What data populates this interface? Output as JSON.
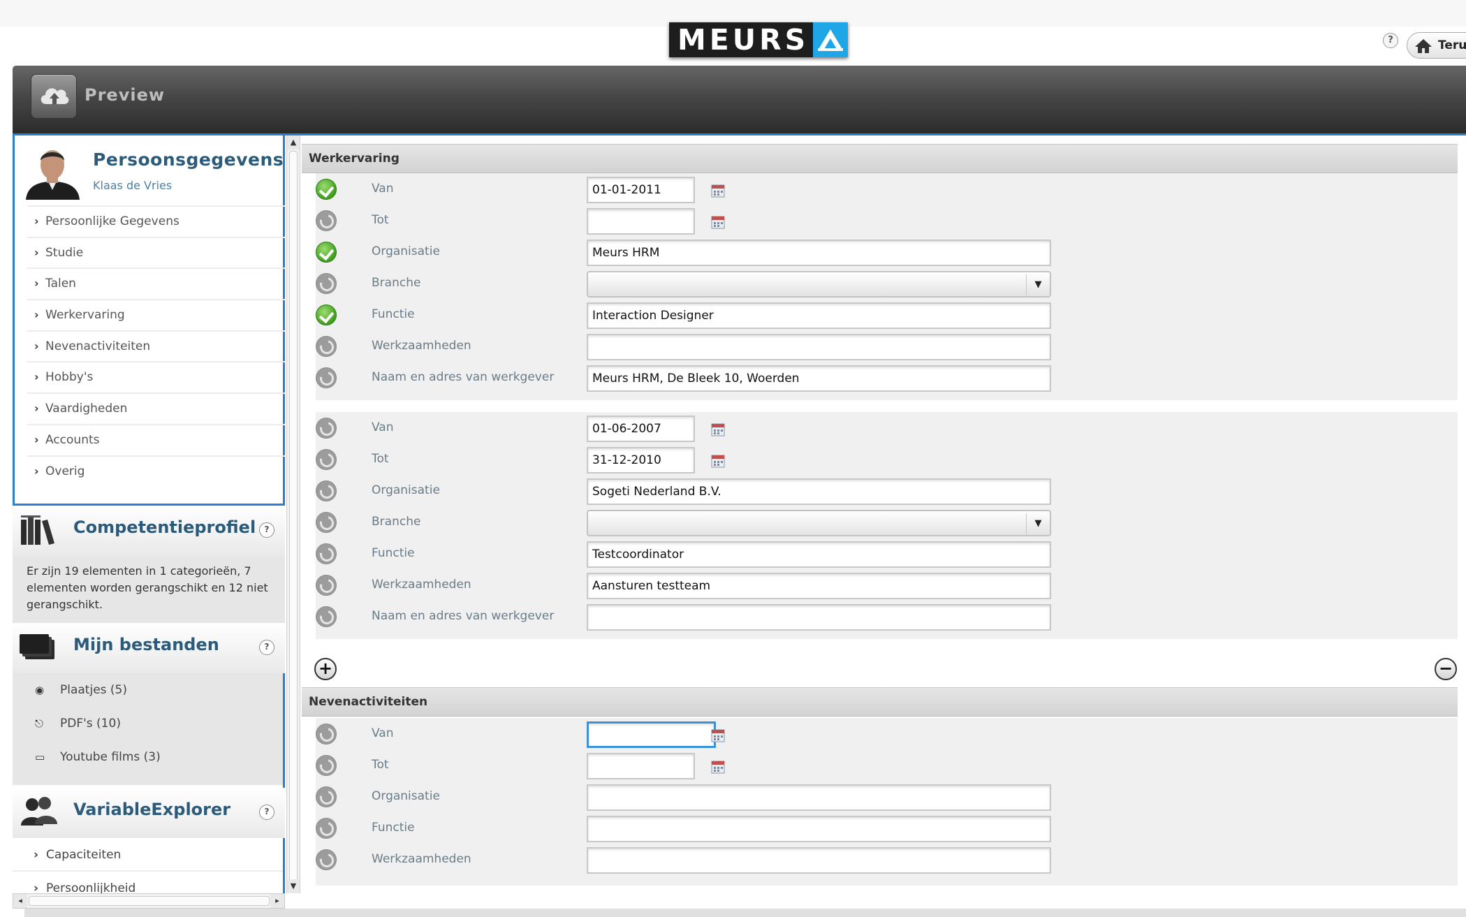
{
  "header": {
    "logo_text": "MEURS",
    "help_label": "?",
    "back_button": "Teru",
    "app_title": "Preview",
    "accent_color": "#2b7fcf",
    "logo_accent_color": "#1ea6e6"
  },
  "sidebar": {
    "profile": {
      "title": "Persoonsgegevens",
      "name": "Klaas de  Vries",
      "items": [
        {
          "label": "Persoonlijke Gegevens"
        },
        {
          "label": "Studie"
        },
        {
          "label": "Talen"
        },
        {
          "label": "Werkervaring"
        },
        {
          "label": "Nevenactiviteiten"
        },
        {
          "label": "Hobby's"
        },
        {
          "label": "Vaardigheden"
        },
        {
          "label": "Accounts"
        },
        {
          "label": "Overig"
        }
      ]
    },
    "competentie": {
      "title": "Competentieprofiel",
      "help": "?",
      "description": "Er zijn 19 elementen in 1 categorieën, 7 elementen worden gerangschikt en 12 niet gerangschikt."
    },
    "bestanden": {
      "title": "Mijn bestanden",
      "help": "?",
      "items": [
        {
          "label": "Plaatjes (5)",
          "icon": "camera-icon"
        },
        {
          "label": "PDF's (10)",
          "icon": "pdf-icon"
        },
        {
          "label": "Youtube films (3)",
          "icon": "video-icon"
        }
      ]
    },
    "explorer": {
      "title": "VariableExplorer",
      "help": "?",
      "items": [
        {
          "label": "Capaciteiten"
        },
        {
          "label": "Persoonlijkheid"
        }
      ]
    }
  },
  "main": {
    "werkervaring": {
      "title": "Werkervaring",
      "entries": [
        {
          "fields": [
            {
              "label": "Van",
              "value": "01-01-2011",
              "status": "ok",
              "type": "date"
            },
            {
              "label": "Tot",
              "value": "",
              "status": "na",
              "type": "date"
            },
            {
              "label": "Organisatie",
              "value": "Meurs HRM",
              "status": "ok",
              "type": "text"
            },
            {
              "label": "Branche",
              "value": "",
              "status": "na",
              "type": "select"
            },
            {
              "label": "Functie",
              "value": "Interaction Designer",
              "status": "ok",
              "type": "text"
            },
            {
              "label": "Werkzaamheden",
              "value": "",
              "status": "na",
              "type": "text"
            },
            {
              "label": "Naam en adres van werkgever",
              "value": "Meurs HRM, De Bleek 10, Woerden",
              "status": "na",
              "type": "text"
            }
          ]
        },
        {
          "fields": [
            {
              "label": "Van",
              "value": "01-06-2007",
              "status": "na",
              "type": "date"
            },
            {
              "label": "Tot",
              "value": "31-12-2010",
              "status": "na",
              "type": "date"
            },
            {
              "label": "Organisatie",
              "value": "Sogeti Nederland B.V.",
              "status": "na",
              "type": "text"
            },
            {
              "label": "Branche",
              "value": "",
              "status": "na",
              "type": "select"
            },
            {
              "label": "Functie",
              "value": "Testcoordinator",
              "status": "na",
              "type": "text"
            },
            {
              "label": "Werkzaamheden",
              "value": "Aansturen testteam",
              "status": "na",
              "type": "text"
            },
            {
              "label": "Naam en adres van werkgever",
              "value": "",
              "status": "na",
              "type": "text"
            }
          ]
        }
      ],
      "add_label": "+",
      "remove_label": "−"
    },
    "nevenactiviteiten": {
      "title": "Nevenactiviteiten",
      "fields": [
        {
          "label": "Van",
          "value": "",
          "status": "na",
          "type": "date",
          "focused": true
        },
        {
          "label": "Tot",
          "value": "",
          "status": "na",
          "type": "date"
        },
        {
          "label": "Organisatie",
          "value": "",
          "status": "na",
          "type": "text"
        },
        {
          "label": "Functie",
          "value": "",
          "status": "na",
          "type": "text"
        },
        {
          "label": "Werkzaamheden",
          "value": "",
          "status": "na",
          "type": "text"
        }
      ]
    }
  }
}
